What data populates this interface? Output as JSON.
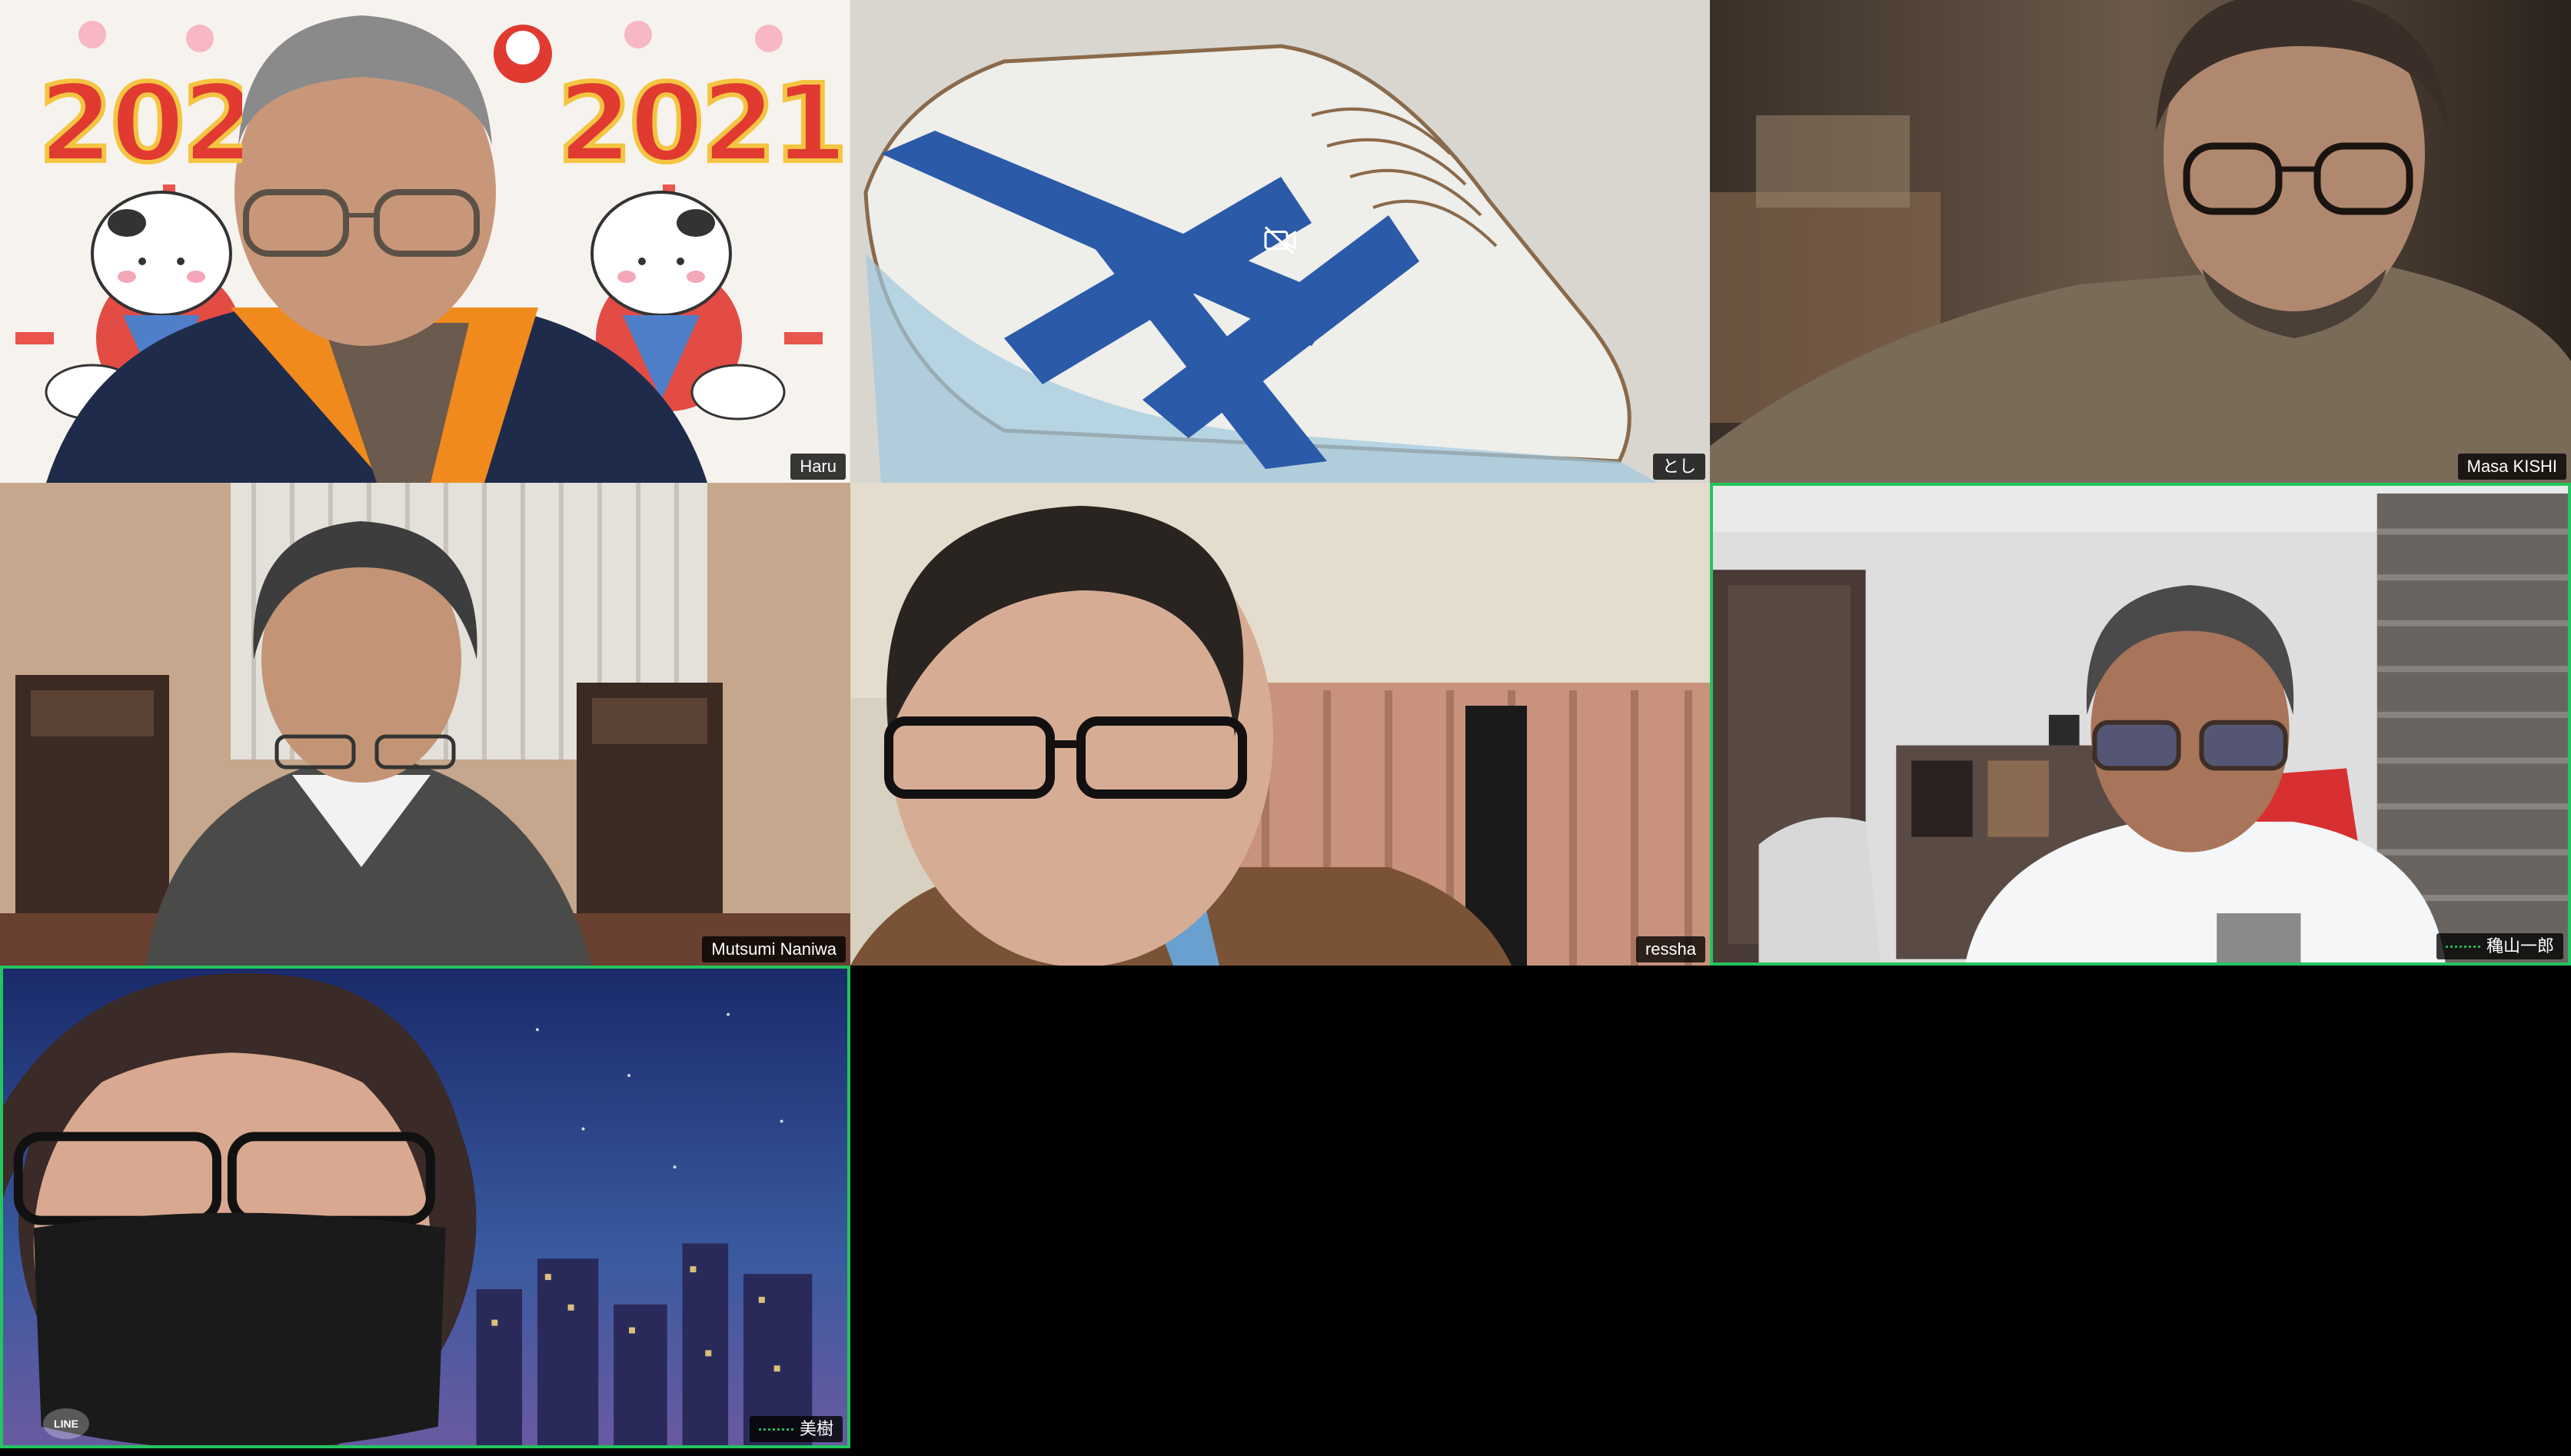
{
  "participants": [
    {
      "name": "Haru",
      "speaking": false,
      "camera_off": false
    },
    {
      "name": "とし",
      "speaking": false,
      "camera_off": true
    },
    {
      "name": "Masa KISHI",
      "speaking": false,
      "camera_off": false
    },
    {
      "name": "Mutsumi Naniwa",
      "speaking": false,
      "camera_off": false
    },
    {
      "name": "ressha",
      "speaking": false,
      "camera_off": false
    },
    {
      "name": "穐山一郎",
      "speaking": true,
      "camera_off": false
    },
    {
      "name": "美樹",
      "speaking": true,
      "camera_off": false
    }
  ],
  "background_text": {
    "year_left": "2021",
    "year_right": "2021"
  },
  "watermark": "LINE",
  "colors": {
    "active_speaker_border": "#23c55e",
    "name_tag_bg": "#000000"
  },
  "icons": {
    "camera_off": "video-off-icon",
    "mic_active": "mic-activity-icon"
  }
}
